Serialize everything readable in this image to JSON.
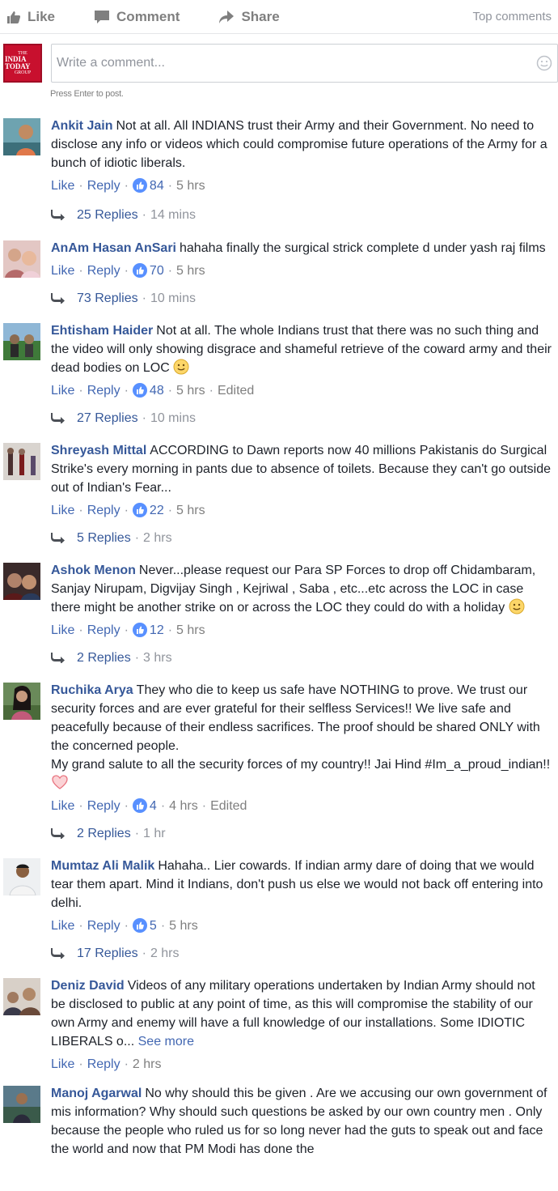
{
  "actions": {
    "like": "Like",
    "comment": "Comment",
    "share": "Share",
    "sort": "Top comments"
  },
  "composer": {
    "placeholder": "Write a comment...",
    "hint": "Press Enter to post.",
    "logo": {
      "line1": "THE",
      "line2": "INDIA TODAY",
      "line3": "GROUP"
    }
  },
  "labels": {
    "like": "Like",
    "reply": "Reply",
    "edited": "Edited",
    "see_more": "See more"
  },
  "comments": [
    {
      "author": "Ankit Jain",
      "text": "Not at all. All INDIANS trust their Army and their Government. No need to disclose any info or videos which could compromise future operations of the Army for a bunch of idiotic liberals.",
      "reactions": "84",
      "time": "5 hrs",
      "replies": "25 Replies",
      "reply_time": "14 mins"
    },
    {
      "author": "AnAm Hasan AnSari",
      "text": "hahaha finally the surgical strick complete d under yash raj films",
      "reactions": "70",
      "time": "5 hrs",
      "replies": "73 Replies",
      "reply_time": "10 mins"
    },
    {
      "author": "Ehtisham Haider",
      "text": "Not at all. The whole Indians trust that there was no such thing and the video will only showing disgrace and shameful retrieve of the coward army and their dead bodies on LOC",
      "reactions": "48",
      "time": "5 hrs",
      "replies": "27 Replies",
      "reply_time": "10 mins"
    },
    {
      "author": "Shreyash Mittal",
      "text": "ACCORDING to Dawn reports now 40 millions Pakistanis do Surgical Strike's every morning in pants due to absence of toilets. Because they can't go outside out of Indian's Fear...",
      "reactions": "22",
      "time": "5 hrs",
      "replies": "5 Replies",
      "reply_time": "2 hrs"
    },
    {
      "author": "Ashok Menon",
      "text": "Never...please request our Para SP Forces to drop off Chidambaram, Sanjay Nirupam, Digvijay Singh , Kejriwal , Saba , etc...etc across the LOC in case there might be another strike on or across the LOC they could do with a holiday",
      "reactions": "12",
      "time": "5 hrs",
      "replies": "2 Replies",
      "reply_time": "3 hrs"
    },
    {
      "author": "Ruchika Arya",
      "text": "They who die to keep us safe have NOTHING to prove. We trust our security forces and are ever grateful for their selfless Services!! We live safe and peacefully because of their endless sacrifices. The proof should be shared ONLY with the concerned people.",
      "text2": "My grand salute to all the security forces of my country!! Jai Hind #Im_a_proud_indian!!",
      "reactions": "4",
      "time": "4 hrs",
      "replies": "2 Replies",
      "reply_time": "1 hr"
    },
    {
      "author": "Mumtaz Ali Malik",
      "text": "Hahaha.. Lier cowards. If indian army dare of doing that we would tear them apart. Mind it Indians, don't push us else we would not back off entering into delhi.",
      "reactions": "5",
      "time": "5 hrs",
      "replies": "17 Replies",
      "reply_time": "2 hrs"
    },
    {
      "author": "Deniz David",
      "text": "Videos of any military operations undertaken by Indian Army should not be disclosed to public at any point of time, as this will compromise the stability of our own Army and enemy will have a full knowledge of our installations. Some IDIOTIC LIBERALS o...",
      "time": "2 hrs"
    },
    {
      "author": "Manoj Agarwal",
      "text": "No why should this be given . Are we accusing our own government of mis information? Why should such questions be asked by our own country men . Only because the people who ruled us for so long never had the guts to speak out and face the world and now that PM Modi has done the"
    }
  ],
  "colors": {
    "link": "#365899",
    "action": "#4267b2",
    "muted": "#90949c",
    "brand": "#c8102e"
  }
}
